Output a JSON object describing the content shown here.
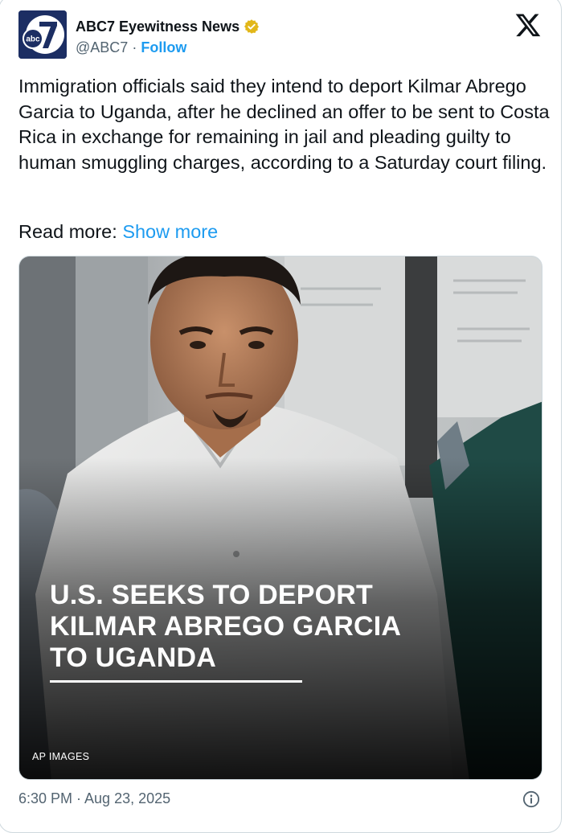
{
  "account": {
    "display_name": "ABC7 Eyewitness News",
    "handle": "@ABC7",
    "separator": "·",
    "follow_label": "Follow",
    "verified_badge_color": "#e2b719",
    "logo_text": "abc7"
  },
  "post": {
    "text": "Immigration officials said they intend to deport Kilmar Abrego Garcia to Uganda, after he declined an offer to be sent to Costa Rica in exchange for remaining in jail and pleading guilty to human smuggling charges, according to a Saturday court filing.",
    "read_more_prefix": "Read more:",
    "show_more_label": "Show more",
    "timestamp": "6:30 PM · Aug 23, 2025"
  },
  "media": {
    "headline_lines": [
      "U.S. SEEKS TO DEPORT",
      "KILMAR ABREGO GARCIA",
      "TO UGANDA"
    ],
    "credit": "AP IMAGES"
  },
  "icons": {
    "platform": "x-logo-icon",
    "verified": "verified-badge-icon",
    "info": "info-icon"
  },
  "colors": {
    "link": "#1d9bf0",
    "secondary_text": "#536471",
    "abc_navy": "#1c2e63"
  }
}
